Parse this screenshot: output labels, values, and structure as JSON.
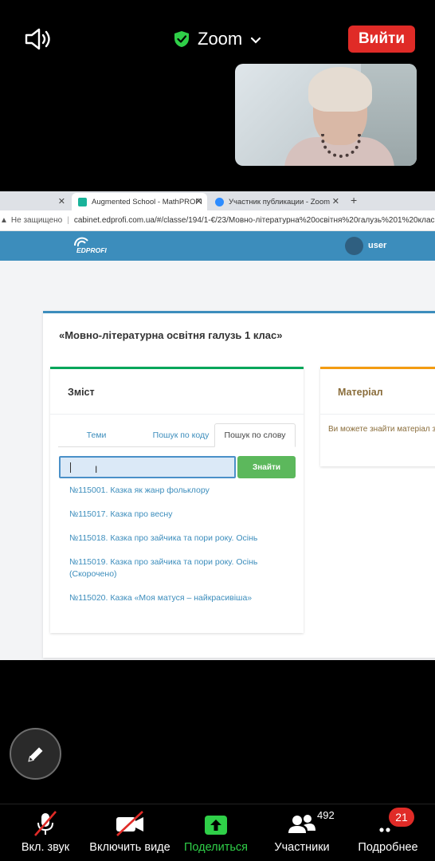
{
  "zoom": {
    "title": "Zoom",
    "exit_label": "Вийти",
    "colors": {
      "exit": "#e02b27",
      "shield": "#2fcf48"
    }
  },
  "browser": {
    "tabs": [
      {
        "label": "Augmented School - MathPROFI"
      },
      {
        "label": "Участник публикации - Zoom"
      }
    ],
    "address": {
      "security": "Не защищено",
      "url": "cabinet.edprofi.com.ua/#/classe/194/1-€/23/Мовно-літературна%20освітня%20галузь%201%20клас"
    }
  },
  "site": {
    "logo": "EDPROFI",
    "user": "user",
    "page_title": "«Мовно-літературна освітня галузь 1 клас»",
    "content": {
      "title": "Зміст",
      "tabs": [
        "Теми",
        "Пошук по коду",
        "Пошук по слову"
      ],
      "search_value": "",
      "find_label": "Знайти",
      "results": [
        "№115001. Казка як жанр фольклору",
        "№115017. Казка про весну",
        "№115018. Казка про зайчика та пори року. Осінь",
        "№115019. Казка про зайчика та пори року. Осінь (Скорочено)",
        "№115020. Казка «Моя матуся – найкрасивіша»"
      ]
    },
    "material": {
      "title": "Матеріал",
      "text": "Ви можете знайти матеріал з"
    }
  },
  "toolbar": {
    "mute_label": "Вкл. звук",
    "video_label": "Включить виде",
    "share_label": "Поделиться",
    "participants_label": "Участники",
    "participants_count": "492",
    "more_label": "Подробнее",
    "more_badge": "21"
  }
}
